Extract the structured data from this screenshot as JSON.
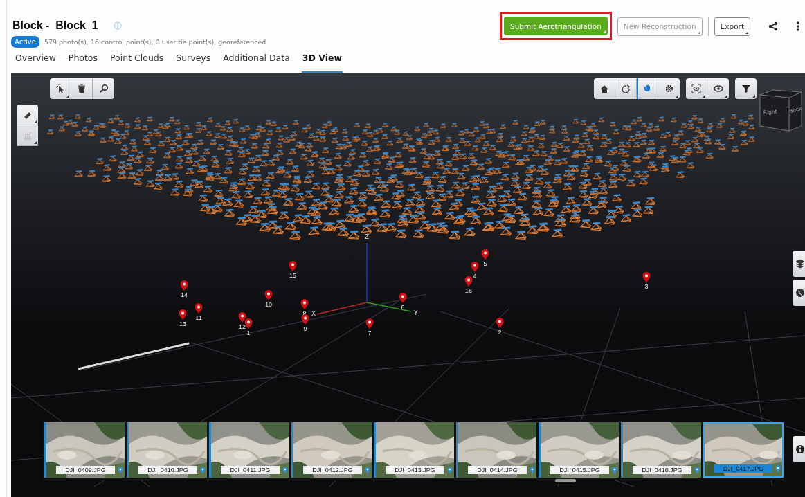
{
  "header": {
    "title": "Block -  Block_1",
    "status": "Active",
    "summary": "579 photo(s), 16 control point(s), 0 user tie point(s), georeferenced"
  },
  "actions": [
    {
      "label": "Submit Aerotriangulation",
      "kind": "primary",
      "highlighted": true,
      "disabled": false
    },
    {
      "label": "New Reconstruction",
      "kind": "secondary",
      "highlighted": false,
      "disabled": true
    },
    {
      "label": "Export",
      "kind": "secondary",
      "highlighted": false,
      "disabled": false
    }
  ],
  "tabs": [
    {
      "label": "Overview",
      "selected": false
    },
    {
      "label": "Photos",
      "selected": false
    },
    {
      "label": "Point Clouds",
      "selected": false
    },
    {
      "label": "Surveys",
      "selected": false
    },
    {
      "label": "Additional Data",
      "selected": false
    },
    {
      "label": "3D View",
      "selected": true
    }
  ],
  "viewer": {
    "nav_tools": [
      {
        "kind": "home",
        "selected": false
      },
      {
        "kind": "orbit",
        "selected": false
      },
      {
        "kind": "pan",
        "selected": true
      },
      {
        "kind": "settings",
        "selected": false
      }
    ],
    "view_cube": {
      "faces": [
        "Right",
        "Back"
      ]
    },
    "axes": [
      "Z",
      "X",
      "Y"
    ],
    "control_points": [
      {
        "label": "14"
      },
      {
        "label": "13"
      },
      {
        "label": "11"
      },
      {
        "label": "12"
      },
      {
        "label": "1"
      },
      {
        "label": "10"
      },
      {
        "label": "15"
      },
      {
        "label": "8"
      },
      {
        "label": "9"
      },
      {
        "label": "7"
      },
      {
        "label": "6"
      },
      {
        "label": "16"
      },
      {
        "label": "4"
      },
      {
        "label": "5"
      },
      {
        "label": "3"
      },
      {
        "label": "2"
      }
    ]
  },
  "filmstrip": [
    {
      "name": "DJI_0409.JPG",
      "selected": false
    },
    {
      "name": "DJI_0410.JPG",
      "selected": false
    },
    {
      "name": "DJI_0411.JPG",
      "selected": false
    },
    {
      "name": "DJI_0412.JPG",
      "selected": false
    },
    {
      "name": "DJI_0413.JPG",
      "selected": false
    },
    {
      "name": "DJI_0414.JPG",
      "selected": false
    },
    {
      "name": "DJI_0415.JPG",
      "selected": false
    },
    {
      "name": "DJI_0416.JPG",
      "selected": false
    },
    {
      "name": "DJI_0417.JPG",
      "selected": true
    }
  ]
}
